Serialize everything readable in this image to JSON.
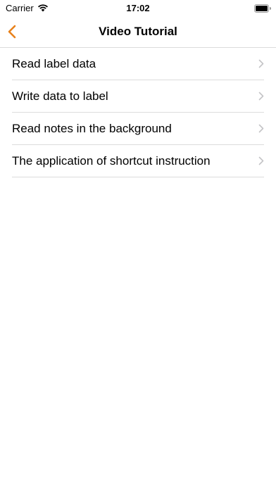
{
  "status_bar": {
    "carrier": "Carrier",
    "time": "17:02",
    "wifi_icon": "wifi-icon",
    "battery_icon": "battery-full-icon"
  },
  "nav": {
    "title": "Video Tutorial",
    "back_icon": "chevron-left-icon",
    "accent_color": "#e8821c"
  },
  "list": {
    "items": [
      {
        "label": "Read label data",
        "icon": "chevron-right-icon"
      },
      {
        "label": "Write data to label",
        "icon": "chevron-right-icon"
      },
      {
        "label": "Read notes in the background",
        "icon": "chevron-right-icon"
      },
      {
        "label": "The application of shortcut instruction",
        "icon": "chevron-right-icon"
      }
    ]
  }
}
